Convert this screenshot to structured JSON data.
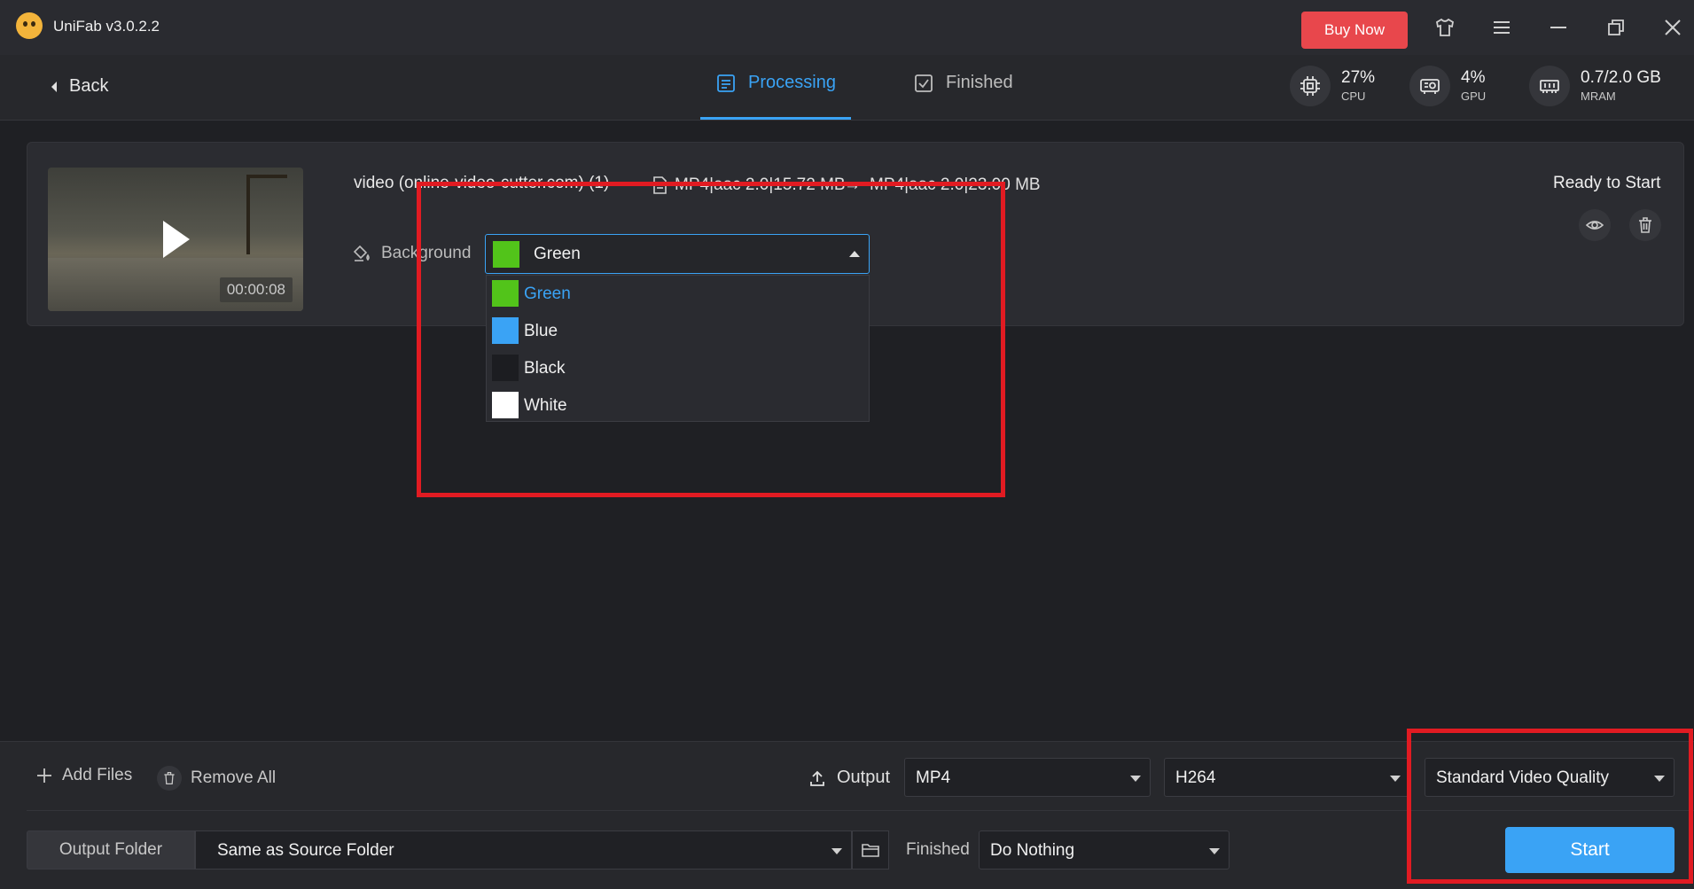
{
  "app": {
    "title": "UniFab v3.0.2.2",
    "buy_label": "Buy Now"
  },
  "nav": {
    "back_label": "Back",
    "tabs": [
      {
        "label": "Processing",
        "active": true
      },
      {
        "label": "Finished",
        "active": false
      }
    ]
  },
  "stats": {
    "cpu": {
      "value": "27%",
      "label": "CPU"
    },
    "gpu": {
      "value": "4%",
      "label": "GPU"
    },
    "mram": {
      "value": "0.7/2.0 GB",
      "label": "MRAM"
    }
  },
  "task": {
    "filename": "video (online-video-cutter.com) (1)",
    "source_meta": "MP4|aac 2.0|15.72 MB",
    "arrow": "→",
    "target_meta": "MP4|aac 2.0|23.00 MB",
    "status": "Ready to Start",
    "duration": "00:00:08",
    "background_label": "Background",
    "background_selected": "Green",
    "background_options": [
      {
        "label": "Green",
        "color": "#52c41a"
      },
      {
        "label": "Blue",
        "color": "#3aa3f5"
      },
      {
        "label": "Black",
        "color": "#1c1d21"
      },
      {
        "label": "White",
        "color": "#ffffff"
      }
    ]
  },
  "bottom": {
    "add_files": "Add Files",
    "remove_all": "Remove All",
    "output_label": "Output",
    "format": "MP4",
    "codec": "H264",
    "quality": "Standard Video Quality",
    "output_folder_label": "Output Folder",
    "output_folder_value": "Same as Source Folder",
    "finished_label": "Finished",
    "finished_action": "Do Nothing",
    "start_label": "Start"
  },
  "colors": {
    "accent": "#3aa3f5",
    "buy": "#e8474c",
    "annotation": "#e11b22"
  }
}
